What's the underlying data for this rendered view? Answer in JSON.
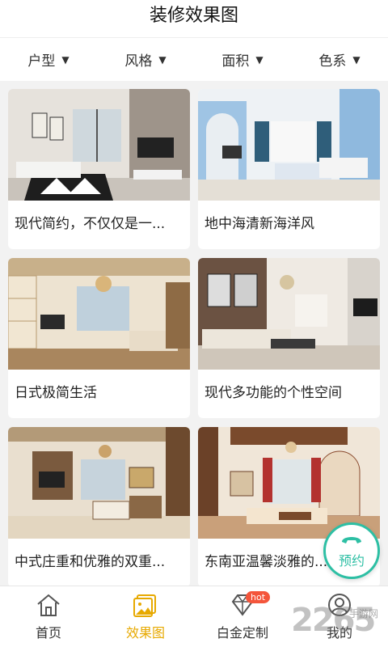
{
  "header": {
    "title": "装修效果图"
  },
  "filters": [
    {
      "label": "户型",
      "icon": "caret-down-icon"
    },
    {
      "label": "风格",
      "icon": "caret-down-icon"
    },
    {
      "label": "面积",
      "icon": "caret-down-icon"
    },
    {
      "label": "色系",
      "icon": "caret-down-icon"
    }
  ],
  "cards": [
    {
      "caption": "现代简约，不仅仅是一...",
      "palette": [
        "#d9d4ce",
        "#2b2b2b"
      ]
    },
    {
      "caption": "地中海清新海洋风",
      "palette": [
        "#a9c9e6",
        "#eef0f2"
      ]
    },
    {
      "caption": "日式极简生活",
      "palette": [
        "#d8c7a8",
        "#9b7a52"
      ]
    },
    {
      "caption": "现代多功能的个性空间",
      "palette": [
        "#6a5344",
        "#e8e3dc"
      ]
    },
    {
      "caption": "中式庄重和优雅的双重...",
      "palette": [
        "#cfc3ae",
        "#7b5a3c"
      ]
    },
    {
      "caption": "东南亚温馨淡雅的...",
      "palette": [
        "#d9b79a",
        "#8a4b2e"
      ]
    }
  ],
  "tabs": [
    {
      "label": "首页",
      "icon": "home-icon"
    },
    {
      "label": "效果图",
      "icon": "gallery-icon"
    },
    {
      "label": "白金定制",
      "icon": "diamond-icon",
      "badge": "hot"
    },
    {
      "label": "我的",
      "icon": "user-icon"
    }
  ],
  "book_button": {
    "label": "预约",
    "icon": "phone-icon"
  },
  "watermark": {
    "number": "2265",
    "text": "手游网"
  },
  "colors": {
    "accent": "#e7a900",
    "book": "#2dbfa4",
    "hot": "#f4553b"
  }
}
